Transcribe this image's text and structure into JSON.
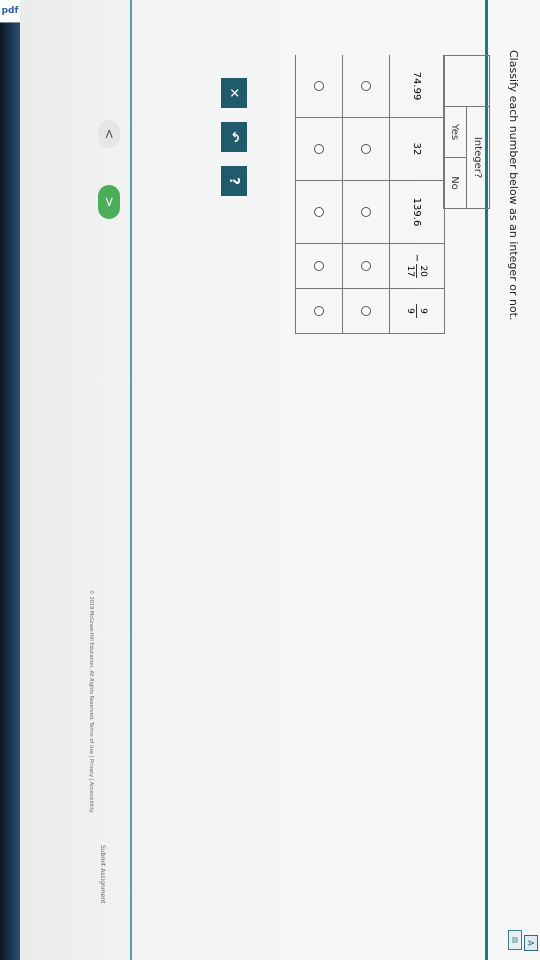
{
  "taskbar": {
    "pdf_label": "pdf"
  },
  "question": {
    "text": "Classify each number below as an integer or not."
  },
  "table": {
    "header_group": "Integer?",
    "header_yes": "Yes",
    "header_no": "No",
    "rows": [
      {
        "value": "74.99"
      },
      {
        "value": "32"
      },
      {
        "value": "139.6"
      },
      {
        "sign": "−",
        "numerator": "20",
        "denominator": "17"
      },
      {
        "numerator": "9",
        "denominator": "9"
      }
    ]
  },
  "actions": {
    "clear_label": "✕",
    "undo_label": "↶",
    "help_label": "?"
  },
  "navigation": {
    "prev_label": "<",
    "next_label": ">"
  },
  "footer": {
    "copyright": "© 2019 McGraw-Hill Education. All Rights Reserved.   Terms of Use  |  Privacy  |  Accessibility",
    "submit_label": "Submit Assignment"
  },
  "colors": {
    "teal": "#1f5b6a",
    "green": "#4cae5a",
    "accent_line": "#1a7a86"
  }
}
